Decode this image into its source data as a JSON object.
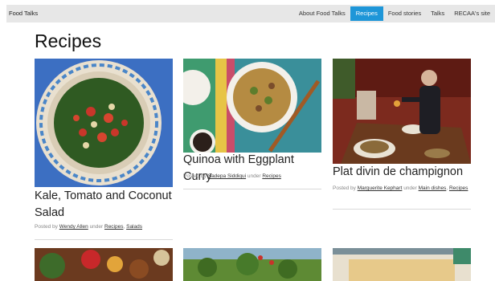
{
  "nav": {
    "brand": "Food Talks",
    "items": [
      {
        "label": "About Food Talks",
        "active": false
      },
      {
        "label": "Recipes",
        "active": true
      },
      {
        "label": "Food stories",
        "active": false
      },
      {
        "label": "Talks",
        "active": false
      },
      {
        "label": "RECAA's site",
        "active": false
      }
    ]
  },
  "page": {
    "title": "Recipes"
  },
  "posts": [
    {
      "title": "Kale, Tomato and Coconut Salad",
      "posted_by_prefix": "Posted by",
      "author": "Wendy Allen",
      "under": "under",
      "category_1": "Recipes",
      "separator": ",",
      "category_2": "Salads"
    },
    {
      "title": "Quinoa with Eggplant Curry",
      "posted_by_prefix": "Posted by",
      "author": "Sadepa Siddiqui",
      "under": "under",
      "category_1": "Recipes"
    },
    {
      "title": "Plat divin de champignon",
      "posted_by_prefix": "Posted by",
      "author": "Marguerite Kephart",
      "under": "under",
      "category_1": "Main dishes",
      "separator": ",",
      "category_2": "Recipes"
    }
  ],
  "colors": {
    "nav_bg": "#e7e7e7",
    "nav_active": "#1e96d8",
    "rule": "#d9d9d9"
  }
}
